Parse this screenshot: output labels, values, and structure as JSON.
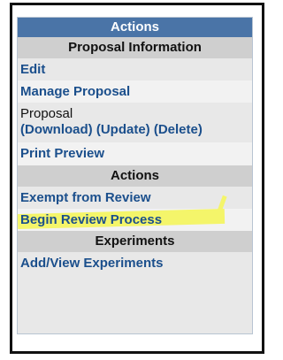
{
  "panel": {
    "title": "Actions",
    "proposal_section": "Proposal Information",
    "edit_label": "Edit",
    "manage_label": "Manage Proposal",
    "proposal_label": "Proposal",
    "download_label": "(Download)",
    "update_label": "(Update)",
    "delete_label": "(Delete)",
    "print_label": "Print Preview",
    "actions_section": "Actions",
    "exempt_label": "Exempt from Review",
    "begin_review_label": "Begin Review Process",
    "experiments_section": "Experiments",
    "add_view_label": "Add/View Experiments"
  },
  "colors": {
    "title_bg": "#4a74a7",
    "section_bg": "#cfcfcf",
    "link": "#1b4f8c",
    "highlight": "#f4f56a"
  }
}
